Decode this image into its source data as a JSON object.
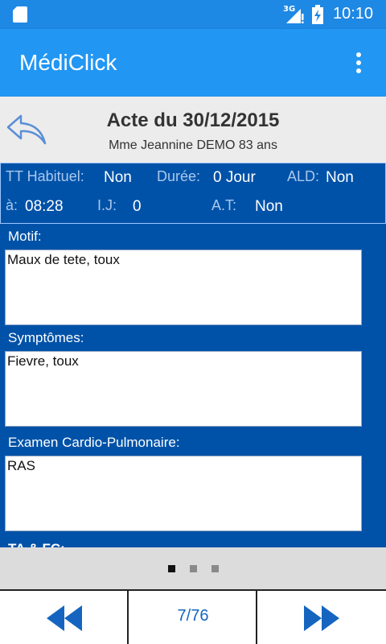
{
  "status_bar": {
    "network": "3G",
    "time": "10:10",
    "icons": [
      "sd-card-icon",
      "signal-icon",
      "battery-charging-icon"
    ]
  },
  "app_bar": {
    "title": "MédiClick",
    "menu_icon": "more-vert-icon"
  },
  "header": {
    "back_icon": "back-arrow-icon",
    "acte_title": "Acte du 30/12/2015",
    "patient": "Mme Jeannine DEMO 83 ans"
  },
  "info": {
    "tt_habituel_label": "TT Habituel:",
    "tt_habituel_value": "Non",
    "duree_label": "Durée:",
    "duree_value": "0 Jour",
    "ald_label": "ALD:",
    "ald_value": "Non",
    "a_label": "à:",
    "a_value": "08:28",
    "ij_label": "I.J:",
    "ij_value": "0",
    "at_label": "A.T:",
    "at_value": "Non"
  },
  "form": {
    "motif_label": "Motif:",
    "motif_value": "Maux de tete, toux",
    "symptomes_label": "Symptômes:",
    "symptomes_value": "Fievre, toux",
    "examen_label": "Examen Cardio-Pulmonaire:",
    "examen_value": "RAS",
    "next_label_partial": "TA & FC:"
  },
  "pager": {
    "dots_count": 3,
    "active_dot": 0,
    "active_color": "#111111",
    "inactive_color": "#8a8a8a"
  },
  "nav": {
    "prev_icon": "rewind-icon",
    "page": "7/76",
    "next_icon": "fast-forward-icon",
    "accent": "#1565c0"
  },
  "colors": {
    "status_bar": "#1e88e5",
    "app_bar": "#2196f3",
    "panel": "#0052a8"
  }
}
